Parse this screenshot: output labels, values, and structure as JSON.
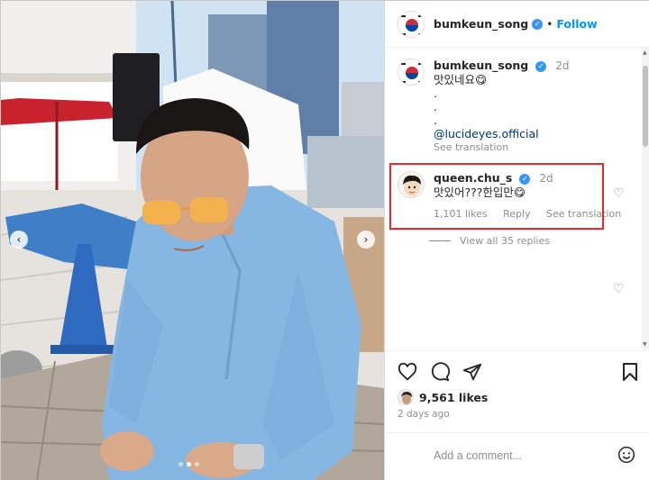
{
  "post": {
    "author": "bumkeun_song",
    "follow_label": "Follow",
    "separator": "•"
  },
  "photo": {
    "prev_arrow": "‹",
    "next_arrow": "›",
    "carousel_dots": 3,
    "active_dot": 1
  },
  "caption": {
    "author": "bumkeun_song",
    "time": "2d",
    "lines": [
      "맛있네요😋",
      ".",
      ".",
      "."
    ],
    "mention": "@lucideyes.official",
    "see_translation": "See translation"
  },
  "reply_comment": {
    "author": "queen.chu_s",
    "time": "2d",
    "text": "맛있어???한입만😋",
    "likes": "1,101 likes",
    "reply_label": "Reply",
    "see_translation": "See translation",
    "view_replies": "View all 35 replies"
  },
  "actions": {
    "like_icon": "heart-icon",
    "comment_icon": "comment-icon",
    "share_icon": "share-icon",
    "save_icon": "bookmark-icon",
    "likes": "9,561 likes",
    "date": "2 days ago"
  },
  "comment_box": {
    "placeholder": "Add a comment..."
  },
  "colors": {
    "accent": "#0095f6",
    "highlight": "#e8262b",
    "verified": "#3897f0"
  }
}
